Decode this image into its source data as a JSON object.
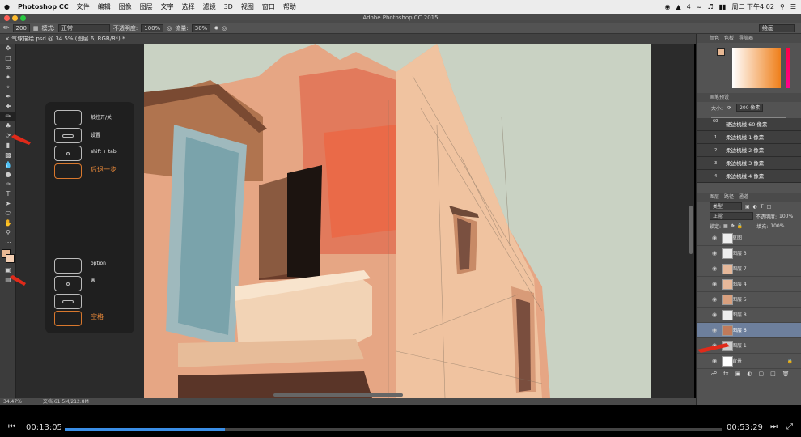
{
  "menubar": {
    "app_name": "Photoshop CC",
    "items": [
      "文件",
      "编辑",
      "图像",
      "图层",
      "文字",
      "选择",
      "滤镜",
      "3D",
      "视图",
      "窗口",
      "帮助"
    ],
    "status_number": "4",
    "clock": "周二 下午4:02"
  },
  "window_title": "Adobe Photoshop CC 2015",
  "options_bar": {
    "brush_size": "200",
    "mode_label": "模式:",
    "mode_value": "正常",
    "opacity_label": "不透明度:",
    "opacity_value": "100%",
    "flow_label": "流量:",
    "flow_value": "30%",
    "workspace": "绘画"
  },
  "document_tab": "气球描绘.psd @ 34.5% (图层 6, RGB/8*) *",
  "status_bar": {
    "zoom": "34.47%",
    "doc_size": "文档:61.5M/212.8M"
  },
  "shortcut_panel": {
    "items": [
      {
        "label": "触控开/关"
      },
      {
        "label": "设置"
      },
      {
        "label": "shift + tab"
      },
      {
        "label": "后退一步"
      },
      {
        "label": "option"
      },
      {
        "label": "⌘"
      },
      {
        "label": ""
      },
      {
        "label": "空格"
      }
    ]
  },
  "color_panel": {
    "tabs": [
      "颜色",
      "色板",
      "导航器"
    ],
    "foreground": "#e8b893",
    "background": "#f3ceb2"
  },
  "brush_presets": {
    "tab": "画笔预设",
    "size_label": "大小:",
    "size_value": "200 像素",
    "items": [
      {
        "count": "60",
        "name": "硬边机械 60 像素"
      },
      {
        "count": "1",
        "name": "柔边机械 1 像素"
      },
      {
        "count": "2",
        "name": "柔边机械 2 像素"
      },
      {
        "count": "3",
        "name": "柔边机械 3 像素"
      },
      {
        "count": "4",
        "name": "柔边机械 4 像素"
      }
    ]
  },
  "layers_panel": {
    "tabs": [
      "图层",
      "路径",
      "通道"
    ],
    "kind_filter": "类型",
    "blend_mode": "正常",
    "opacity_label": "不透明度:",
    "opacity_value": "100%",
    "lock_label": "锁定:",
    "fill_label": "填充:",
    "fill_value": "100%",
    "layers": [
      {
        "name": "草图"
      },
      {
        "name": "图层 3"
      },
      {
        "name": "图层 7"
      },
      {
        "name": "图层 4"
      },
      {
        "name": "图层 5"
      },
      {
        "name": "图层 8"
      },
      {
        "name": "图层 6",
        "active": true
      },
      {
        "name": "图层 1"
      },
      {
        "name": "背景"
      }
    ]
  },
  "player": {
    "current_time": "00:13:05",
    "total_time": "00:53:29",
    "progress": 0.244
  }
}
